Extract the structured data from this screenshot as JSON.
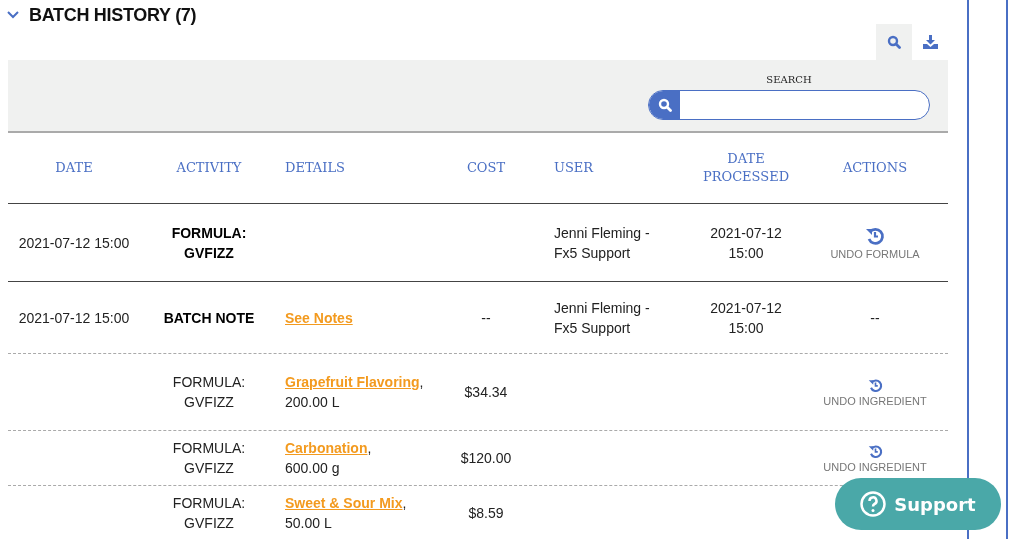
{
  "section": {
    "title": "BATCH HISTORY (7)",
    "expanded": true
  },
  "toolbar": [
    {
      "kind": "search",
      "selected": true
    },
    {
      "kind": "download",
      "selected": false
    }
  ],
  "search": {
    "label": "SEARCH"
  },
  "table": {
    "columns": [
      "DATE",
      "ACTIVITY",
      "DETAILS",
      "COST",
      "USER",
      "DATE PROCESSED",
      "ACTIONS"
    ],
    "rows": [
      {
        "kind": "formula",
        "date": "2021-07-12 15:00",
        "activity": "FORMULA: GVFIZZ",
        "user": "Jenni Fleming - Fx5 Support",
        "processed": "2021-07-12 15:00",
        "action": {
          "kind": "undo",
          "label": "UNDO FORMULA"
        }
      },
      {
        "kind": "note",
        "date": "2021-07-12 15:00",
        "activity": "BATCH NOTE",
        "details": {
          "link": "See Notes"
        },
        "cost": "--",
        "user": "Jenni Fleming - Fx5 Support",
        "processed": "2021-07-12 15:00",
        "action": {
          "kind": "text",
          "label": "--"
        }
      },
      {
        "kind": "ingredient",
        "activity": "FORMULA: GVFIZZ",
        "details": {
          "link": "Grapefruit Flavoring",
          "text": ", 200.00 L"
        },
        "cost": "$34.34",
        "action": {
          "kind": "undo",
          "label": "UNDO INGREDIENT"
        }
      },
      {
        "kind": "ingredient",
        "activity": "FORMULA: GVFIZZ",
        "details": {
          "link": "Carbonation",
          "text": ", 600.00 g"
        },
        "cost": "$120.00",
        "action": {
          "kind": "undo",
          "label": "UNDO INGREDIENT"
        }
      },
      {
        "kind": "ingredient",
        "activity": "FORMULA: GVFIZZ",
        "details": {
          "link": "Sweet & Sour Mix",
          "text": ", 50.00 L"
        },
        "cost": "$8.59"
      }
    ]
  },
  "support_button": {
    "label": "Support"
  }
}
